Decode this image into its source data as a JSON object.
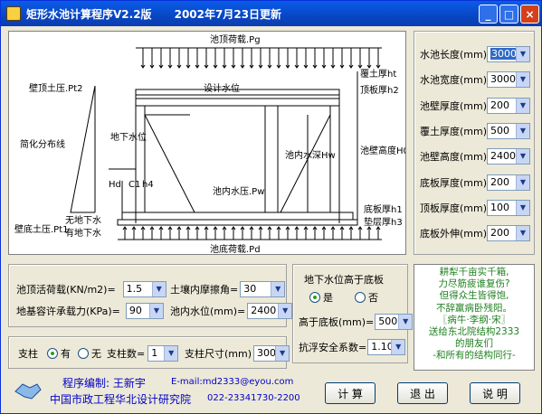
{
  "window": {
    "title": "矩形水池计算程序V2.2版      2002年7月23日更新"
  },
  "titlebar_buttons": {
    "minimize": "_",
    "maximize": "□",
    "close": "×"
  },
  "diagram_labels": {
    "top_load": "池顶荷载.Pg",
    "cover_depth": "覆土厚ht",
    "top_slab": "顶板厚h2",
    "design_level": "设计水位",
    "lateral_pressure": "壁顶土压.Pt2",
    "dist_line": "简化分布线",
    "groundwater_level": "地下水位",
    "inner_water_depth": "池内水深Hw",
    "pool_height": "池壁高度H0",
    "inner_pressure": "池内水压.Pw",
    "hd": "Hd",
    "c1": "C1",
    "h4": "h4",
    "bottom_slab": "底板厚h1",
    "cushion": "垫层厚h3",
    "bottom_pressure": "壁底土压.Pt1",
    "no_gw": "无地下水",
    "has_gw": "有地下水",
    "bottom_load": "池底荷载.Pd"
  },
  "right_params": [
    {
      "label": "水池长度(mm)=",
      "value": "3000",
      "selected": true
    },
    {
      "label": "水池宽度(mm)=",
      "value": "3000"
    },
    {
      "label": "池壁厚度(mm)=",
      "value": "200"
    },
    {
      "label": "覆土厚度(mm)=",
      "value": "500"
    },
    {
      "label": "池壁高度(mm)=",
      "value": "2400"
    },
    {
      "label": "底板厚度(mm)=",
      "value": "200"
    },
    {
      "label": "顶板厚度(mm)=",
      "value": "100"
    },
    {
      "label": "底板外伸(mm)=",
      "value": "200"
    }
  ],
  "loads": {
    "live_load_label": "池顶活荷载(KN/m2)=",
    "live_load_value": "1.5",
    "friction_label": "土壤内摩擦角=",
    "friction_value": "30",
    "bearing_label": "地基容许承载力(KPa)=",
    "bearing_value": "90",
    "water_level_label": "池内水位(mm)=",
    "water_level_value": "2400"
  },
  "groundwater": {
    "title": "地下水位高于底板",
    "yes": "是",
    "no": "否",
    "height_label": "高于底板(mm)=",
    "height_value": "500",
    "safety_label": "抗浮安全系数=",
    "safety_value": "1.10"
  },
  "column": {
    "label": "支柱",
    "yes": "有",
    "no": "无",
    "count_label": "支柱数=",
    "count_value": "1",
    "size_label": "支柱尺寸(mm)",
    "size_value": "300"
  },
  "poem": [
    "耕犁千亩实千箱,",
    "力尽筋疲谁复伤?",
    "但得众生皆得饱,",
    "不辞羸病卧残阳。",
    "〖病牛·李纲·宋〗",
    "送给东北院结构2333",
    "的朋友们",
    "-和所有的结构同行-"
  ],
  "credits": {
    "author": "程序编制: 王新宇",
    "email": "E-mail:md2333@eyou.com",
    "org": "中国市政工程华北设计研究院",
    "phone": "022-23341730-2200"
  },
  "buttons": {
    "calc": "计 算",
    "exit": "退 出",
    "help": "说 明"
  }
}
